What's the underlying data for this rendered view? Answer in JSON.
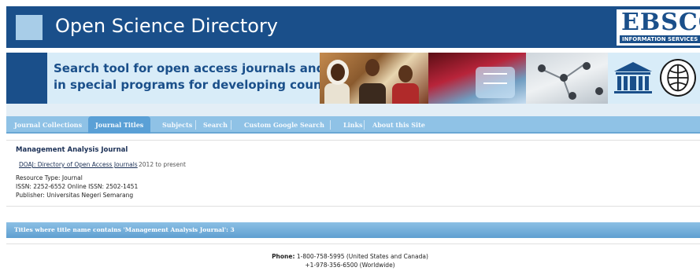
{
  "header": {
    "site_title": "Open Science Directory",
    "ebsco_logo_text": "EBSCO",
    "ebsco_logo_sub": "INFORMATION SERVICES"
  },
  "banner": {
    "tagline_line1": "Search tool for open access journals and journals",
    "tagline_line2": "in special programs for developing countries",
    "images": [
      "children-photo",
      "lab-flask-photo",
      "molecule-photo",
      "unesco-logo",
      "globe-logo"
    ]
  },
  "nav": {
    "items": [
      {
        "label": "Journal Collections",
        "active": false
      },
      {
        "label": "Journal Titles",
        "active": true
      },
      {
        "label": "Subjects",
        "active": false
      },
      {
        "label": "Search",
        "active": false
      },
      {
        "label": "Custom Google Search",
        "active": false
      },
      {
        "label": "Links",
        "active": false
      },
      {
        "label": "About this Site",
        "active": false
      }
    ]
  },
  "record": {
    "title": "Management Analysis Journal",
    "collection_link": "DOAJ: Directory of Open Access Journals",
    "coverage": "2012 to present",
    "resource_type": "Resource Type: Journal",
    "issn": "ISSN: 2252-6552 Online ISSN: 2502-1451",
    "publisher": "Publisher: Universitas Negeri Semarang"
  },
  "results": {
    "summary": "Titles where title name contains 'Management Analysis Journal': 3"
  },
  "footer": {
    "phone_label": "Phone:",
    "phone_us": "1-800-758-5995 (United States and Canada)",
    "phone_world": "+1-978-356-6500 (Worldwide)"
  },
  "colors": {
    "header_blue": "#1a4f8a",
    "nav_blue": "#8fc2e6",
    "nav_active": "#5aa0d6",
    "results_bar": "#6aa7d4"
  }
}
